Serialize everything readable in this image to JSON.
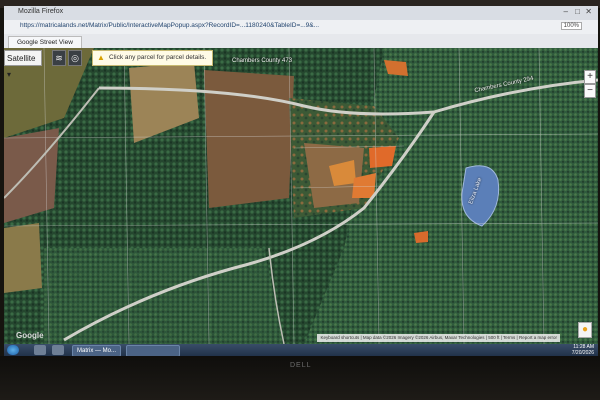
{
  "window": {
    "title": "Mozilla Firefox",
    "url": "https://matricalands.net/Matrix/Public/InteractiveMapPopup.aspx?RecordID=...1180240&TableID=...9&...",
    "zoom": "100%"
  },
  "tabs": [
    {
      "label": "Google Street View"
    }
  ],
  "map": {
    "map_type_label": "Satellite",
    "hint_text": "Click any parcel for parcel details.",
    "roads": [
      {
        "label": "Chambers County 473"
      },
      {
        "label": "Chambers County 294"
      }
    ],
    "water_label": "Eliza Lake",
    "attribution": "Keyboard shortcuts  |  Map data ©2026 Imagery ©2026 Airbus, Maxar Technologies  |  500 ft  |  Terms  |  Report a map error",
    "google_logo": "Google",
    "zoom_in": "+",
    "zoom_out": "−",
    "colors": {
      "forest_dark": "#1f3b2a",
      "forest_mid": "#2d5a3a",
      "clearcut": "#8b6a45",
      "orange_patch": "#e06a2a",
      "road": "#cfcfc8",
      "water": "#5b7fb8"
    }
  },
  "taskbar": {
    "window_label": "Matrix — Mo...",
    "time": "11:28 AM",
    "date": "7/20/2026"
  },
  "monitor": {
    "brand": "DELL"
  }
}
